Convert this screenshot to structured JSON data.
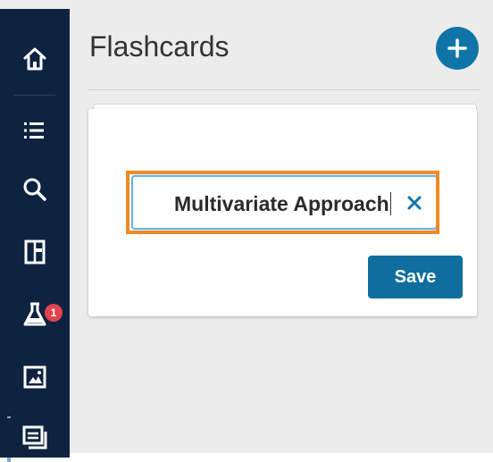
{
  "page": {
    "title": "Flashcards"
  },
  "sidebar": {
    "items": [
      {
        "icon": "home-icon"
      },
      {
        "icon": "list-icon"
      },
      {
        "icon": "search-icon"
      },
      {
        "icon": "notebook-icon"
      },
      {
        "icon": "flask-icon",
        "badge": "1"
      },
      {
        "icon": "image-icon"
      },
      {
        "icon": "flashcards-icon",
        "active": true
      }
    ]
  },
  "editor": {
    "input_value": "Multivariate Approach",
    "save_label": "Save"
  },
  "colors": {
    "sidebar_bg": "#0d2340",
    "accent": "#0f75a8",
    "highlight": "#f08a24",
    "badge": "#e2434e"
  }
}
